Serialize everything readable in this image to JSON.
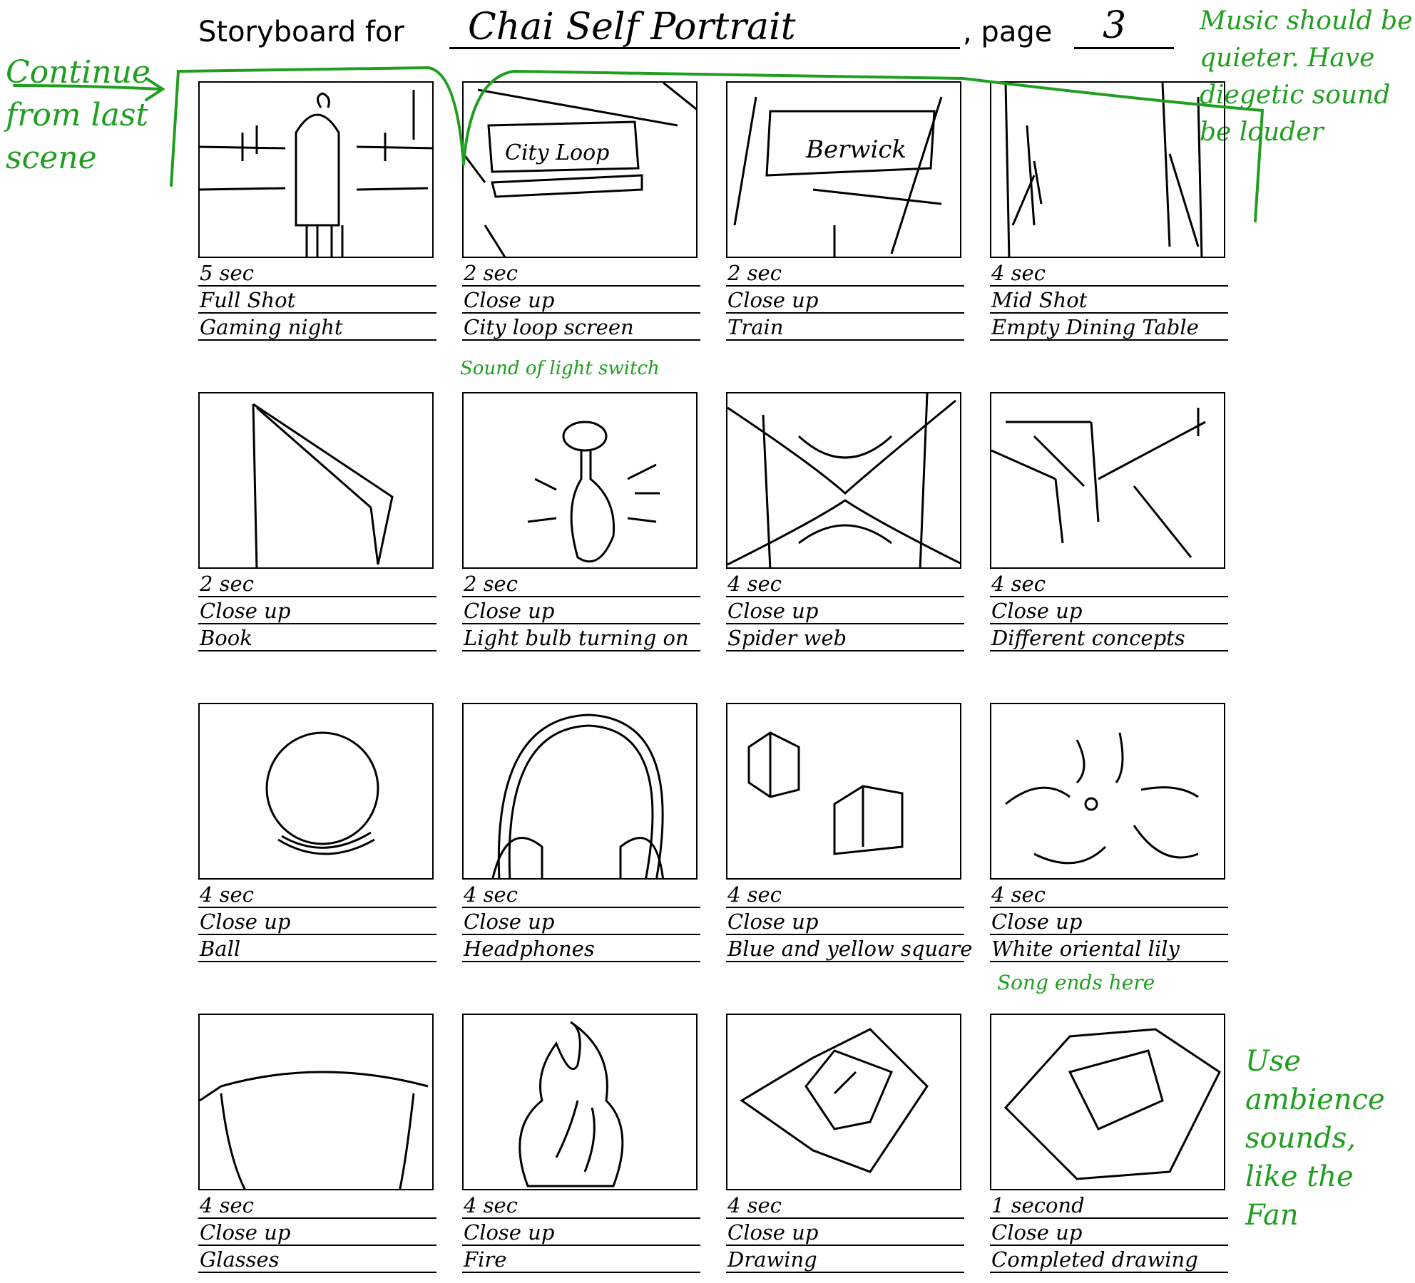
{
  "header": {
    "prefix": "Storyboard for",
    "title": "Chai Self Portrait",
    "page_label": ", page",
    "page_number": "3"
  },
  "annotations": {
    "continue": "Continue from last scene",
    "music": "Music should be quieter. Have diegetic sound be louder",
    "light_sound": "Sound of light switch",
    "song_ends": "Song ends here",
    "ambience": "Use ambience sounds, like the Fan"
  },
  "panels": [
    {
      "duration": "5 sec",
      "shot": "Full Shot",
      "subject": "Gaming night"
    },
    {
      "duration": "2 sec",
      "shot": "Close up",
      "subject": "City loop screen"
    },
    {
      "duration": "2 sec",
      "shot": "Close up",
      "subject": "Train"
    },
    {
      "duration": "4 sec",
      "shot": "Mid Shot",
      "subject": "Empty Dining Table"
    },
    {
      "duration": "2 sec",
      "shot": "Close up",
      "subject": "Book"
    },
    {
      "duration": "2 sec",
      "shot": "Close up",
      "subject": "Light bulb turning on"
    },
    {
      "duration": "4 sec",
      "shot": "Close up",
      "subject": "Spider web"
    },
    {
      "duration": "4 sec",
      "shot": "Close up",
      "subject": "Different concepts"
    },
    {
      "duration": "4 sec",
      "shot": "Close up",
      "subject": "Ball"
    },
    {
      "duration": "4 sec",
      "shot": "Close up",
      "subject": "Headphones"
    },
    {
      "duration": "4 sec",
      "shot": "Close up",
      "subject": "Blue and yellow square"
    },
    {
      "duration": "4 sec",
      "shot": "Close up",
      "subject": "White oriental lily"
    },
    {
      "duration": "4 sec",
      "shot": "Close up",
      "subject": "Glasses"
    },
    {
      "duration": "4 sec",
      "shot": "Close up",
      "subject": "Fire"
    },
    {
      "duration": "4 sec",
      "shot": "Close up",
      "subject": "Drawing"
    },
    {
      "duration": "1 second",
      "shot": "Close up",
      "subject": "Completed drawing"
    }
  ],
  "sketch_text": {
    "screen_text": "City Loop",
    "train_sign": "Berwick"
  },
  "colors": {
    "ink": "#000000",
    "annotation_green": "#1f9e1f"
  }
}
